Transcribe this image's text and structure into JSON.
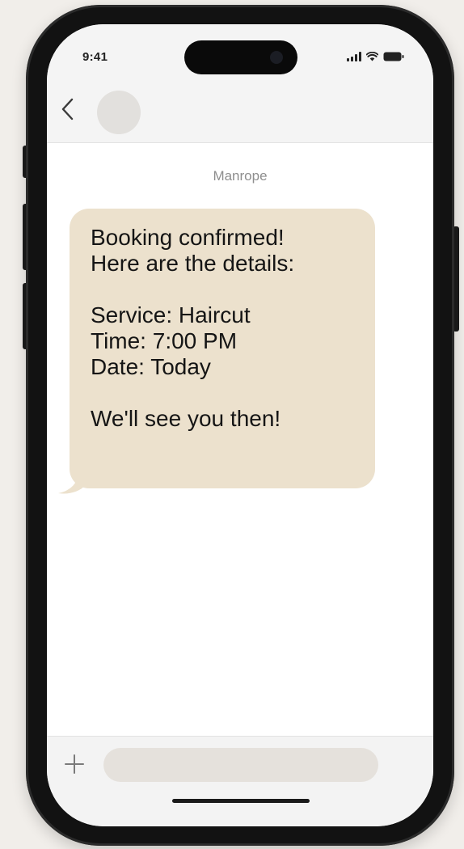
{
  "status_bar": {
    "time": "9:41",
    "icons": [
      "signal-icon",
      "wifi-icon",
      "battery-icon"
    ]
  },
  "header": {
    "back_icon": "chevron-left-icon",
    "avatar": "contact-avatar"
  },
  "conversation": {
    "sender": "Manrope",
    "message": {
      "lines": [
        "Booking confirmed!",
        "Here are the details:",
        "",
        "Service: Haircut",
        "Time: 7:00 PM",
        "Date: Today",
        "",
        "We'll see you then!"
      ],
      "bubble_color": "#ece1cd"
    }
  },
  "composer": {
    "plus_icon": "plus-icon",
    "input_value": "",
    "input_placeholder": ""
  },
  "colors": {
    "background": "#f1eeea",
    "frame": "#121212",
    "header": "#f4f4f4",
    "bubble": "#ece1cd",
    "input": "#e5e1dc"
  }
}
